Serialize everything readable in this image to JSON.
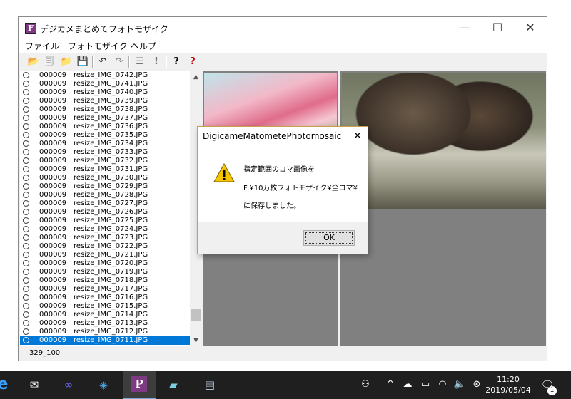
{
  "window": {
    "title": "デジカメまとめてフォトモザイク",
    "app_icon_letter": "F",
    "minimize_glyph": "—",
    "maximize_glyph": "☐",
    "close_glyph": "✕"
  },
  "menu": [
    "ファイル",
    "フォトモザイク",
    "ヘルプ"
  ],
  "toolbar": {
    "open": "📂",
    "new": "🗐",
    "folder": "📁",
    "save": "💾",
    "undo": "↶",
    "redo": "↷",
    "list": "☰",
    "mark": "!",
    "help": "?",
    "help2": "?"
  },
  "file_list": [
    {
      "num": "000009",
      "file": "resize_IMG_0742.JPG"
    },
    {
      "num": "000009",
      "file": "resize_IMG_0741.JPG"
    },
    {
      "num": "000009",
      "file": "resize_IMG_0740.JPG"
    },
    {
      "num": "000009",
      "file": "resize_IMG_0739.JPG"
    },
    {
      "num": "000009",
      "file": "resize_IMG_0738.JPG"
    },
    {
      "num": "000009",
      "file": "resize_IMG_0737.JPG"
    },
    {
      "num": "000009",
      "file": "resize_IMG_0736.JPG"
    },
    {
      "num": "000009",
      "file": "resize_IMG_0735.JPG"
    },
    {
      "num": "000009",
      "file": "resize_IMG_0734.JPG"
    },
    {
      "num": "000009",
      "file": "resize_IMG_0733.JPG"
    },
    {
      "num": "000009",
      "file": "resize_IMG_0732.JPG"
    },
    {
      "num": "000009",
      "file": "resize_IMG_0731.JPG"
    },
    {
      "num": "000009",
      "file": "resize_IMG_0730.JPG"
    },
    {
      "num": "000009",
      "file": "resize_IMG_0729.JPG"
    },
    {
      "num": "000009",
      "file": "resize_IMG_0728.JPG"
    },
    {
      "num": "000009",
      "file": "resize_IMG_0727.JPG"
    },
    {
      "num": "000009",
      "file": "resize_IMG_0726.JPG"
    },
    {
      "num": "000009",
      "file": "resize_IMG_0725.JPG"
    },
    {
      "num": "000009",
      "file": "resize_IMG_0724.JPG"
    },
    {
      "num": "000009",
      "file": "resize_IMG_0723.JPG"
    },
    {
      "num": "000009",
      "file": "resize_IMG_0722.JPG"
    },
    {
      "num": "000009",
      "file": "resize_IMG_0721.JPG"
    },
    {
      "num": "000009",
      "file": "resize_IMG_0720.JPG"
    },
    {
      "num": "000009",
      "file": "resize_IMG_0719.JPG"
    },
    {
      "num": "000009",
      "file": "resize_IMG_0718.JPG"
    },
    {
      "num": "000009",
      "file": "resize_IMG_0717.JPG"
    },
    {
      "num": "000009",
      "file": "resize_IMG_0716.JPG"
    },
    {
      "num": "000009",
      "file": "resize_IMG_0715.JPG"
    },
    {
      "num": "000009",
      "file": "resize_IMG_0714.JPG"
    },
    {
      "num": "000009",
      "file": "resize_IMG_0713.JPG"
    },
    {
      "num": "000009",
      "file": "resize_IMG_0712.JPG"
    },
    {
      "num": "000009",
      "file": "resize_IMG_0711.JPG",
      "selected": true
    }
  ],
  "status_text": "329_100",
  "dialog": {
    "title": "DigicameMatometePhotomosaic",
    "close_glyph": "✕",
    "lines": [
      "指定範囲のコマ画像を",
      "F:¥10万枚フォトモザイク¥全コマ¥",
      "に保存しました。"
    ],
    "ok_label": "OK"
  },
  "taskbar": {
    "time": "11:20",
    "date": "2019/05/04",
    "notification_count": "1"
  },
  "colors": {
    "selection": "#0078d7",
    "taskbar": "#1f1f1f",
    "pane_bg": "#808080",
    "dialog_border": "#c8a24a"
  }
}
